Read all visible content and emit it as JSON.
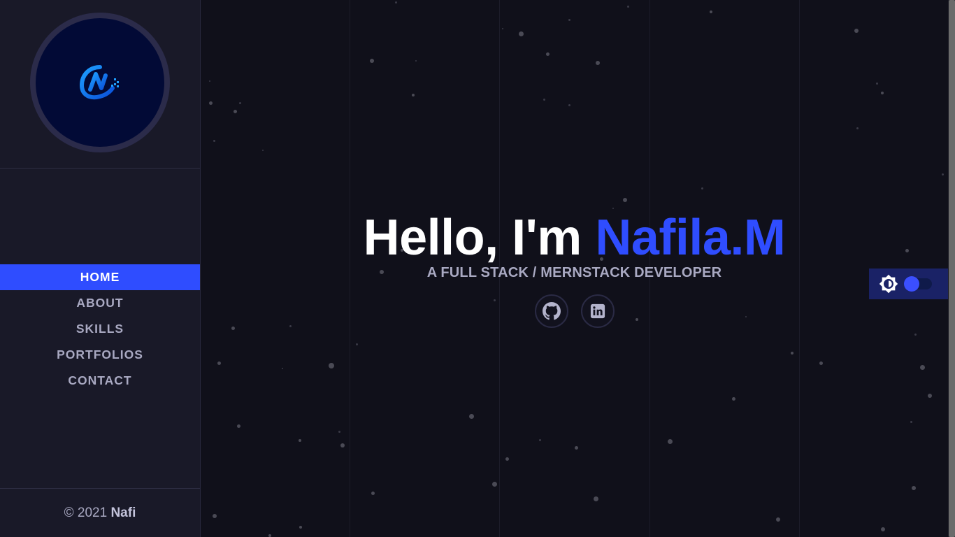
{
  "sidebar": {
    "logo_icon": "n-logo-icon",
    "nav": [
      {
        "label": "HOME",
        "active": true
      },
      {
        "label": "ABOUT",
        "active": false
      },
      {
        "label": "SKILLS",
        "active": false
      },
      {
        "label": "PORTFOLIOS",
        "active": false
      },
      {
        "label": "CONTACT",
        "active": false
      }
    ],
    "footer": {
      "copyright": "© 2021",
      "author": "Nafi"
    }
  },
  "hero": {
    "greeting": "Hello, I'm",
    "name": "Nafila.M",
    "subtitle": "A FULL STACK / MERNSTACK DEVELOPER"
  },
  "socials": [
    {
      "icon": "github-icon"
    },
    {
      "icon": "linkedin-icon"
    }
  ],
  "theme_toggle": {
    "icon": "brightness-icon",
    "state": "dark"
  },
  "colors": {
    "accent": "#2f4dff",
    "background": "#10101a",
    "sidebar": "#191928",
    "text_muted": "#a9a9c2"
  }
}
